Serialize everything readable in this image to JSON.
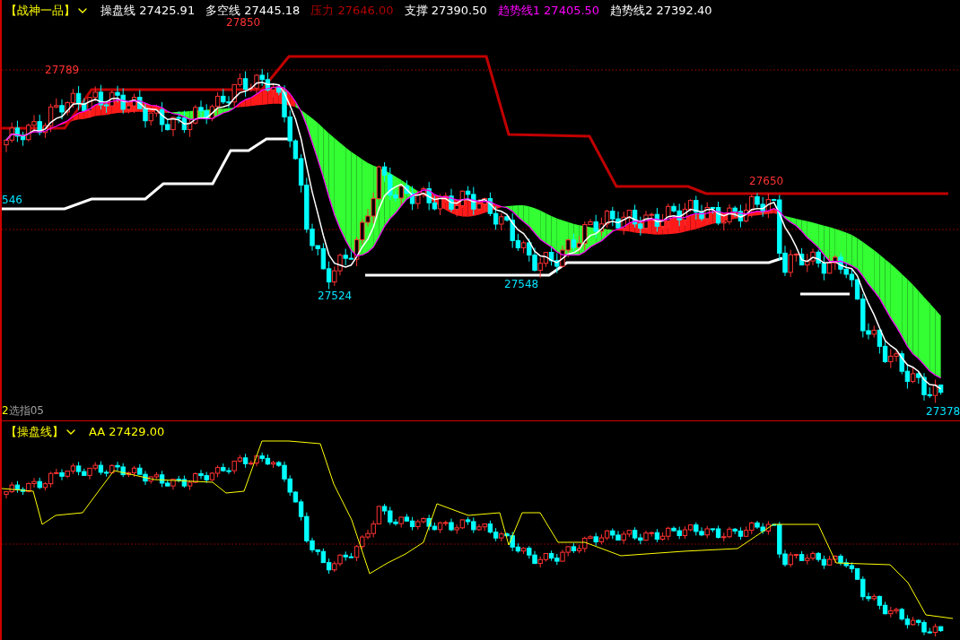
{
  "main_panel": {
    "title": "【战神一品】",
    "legend": [
      {
        "label": "操盘线 27425.91",
        "color": "#ffffff"
      },
      {
        "label": "多空线 27445.18",
        "color": "#ffffff"
      },
      {
        "label": "压力 27646.00",
        "color": "#b00000"
      },
      {
        "label": "支撑 27390.50",
        "color": "#ffffff"
      },
      {
        "label": "趋势线1 27405.50",
        "color": "#ff00ff"
      },
      {
        "label": "趋势线2 27392.40",
        "color": "#ffffff"
      }
    ],
    "price_labels": [
      {
        "text": "27850",
        "color": "#ff3232"
      },
      {
        "text": "27789",
        "color": "#ff3232"
      },
      {
        "text": "546",
        "color": "#00e5ff"
      },
      {
        "text": "27524",
        "color": "#00e5ff"
      },
      {
        "text": "27548",
        "color": "#00e5ff"
      },
      {
        "text": "27650",
        "color": "#ff3232"
      },
      {
        "text": "27378",
        "color": "#00e5ff"
      }
    ],
    "period_marks": [
      {
        "text": "2",
        "color": "#ffff00"
      },
      {
        "text": "选指05",
        "color": "#a0a0a0"
      }
    ]
  },
  "sub_panel": {
    "title": "【操盘线】",
    "legend": [
      {
        "label": "AA 27429.00",
        "color": "#ffff00"
      }
    ]
  }
}
